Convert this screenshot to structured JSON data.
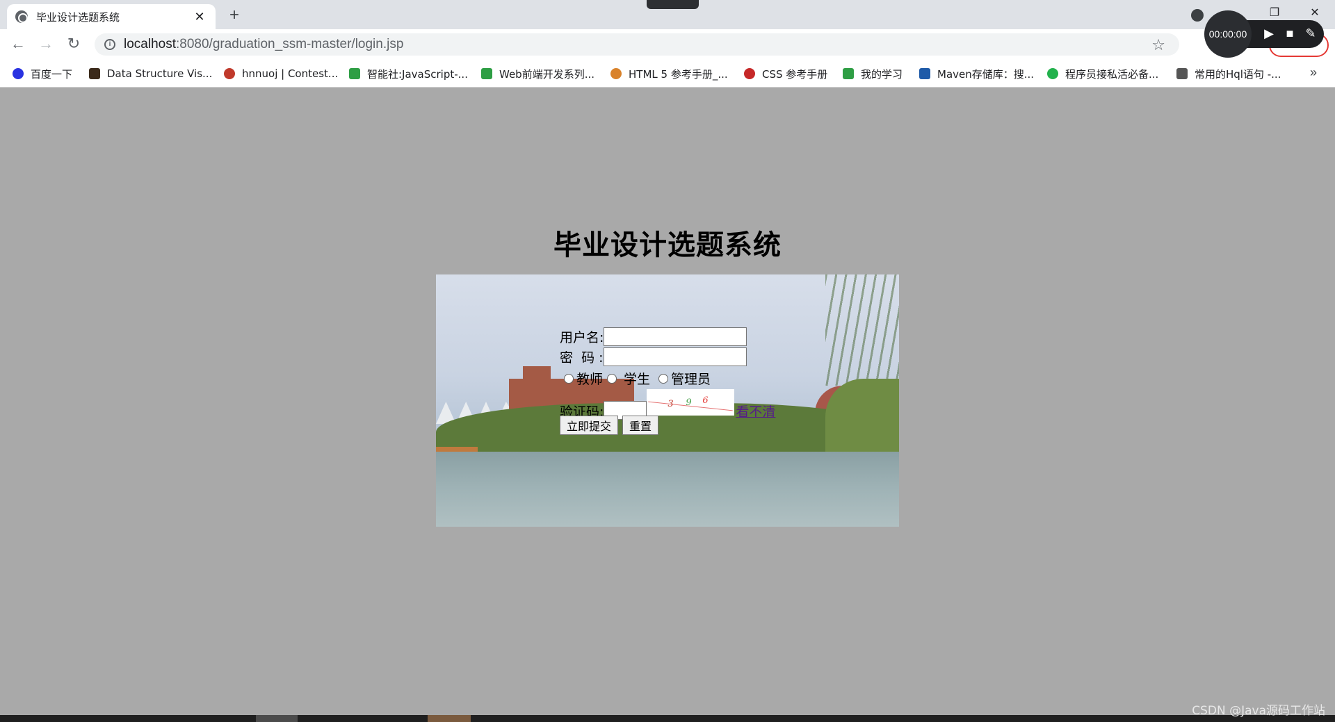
{
  "browser": {
    "tab_title": "毕业设计选题系统",
    "url_host": "localhost",
    "url_path": ":8080/graduation_ssm-master/login.jsp",
    "recorder_time": "00:00:00"
  },
  "bookmarks": [
    {
      "label": "百度一下",
      "color": "#2932e1"
    },
    {
      "label": "Data Structure Vis...",
      "color": "#3b2a1a"
    },
    {
      "label": "hnnuoj | Contest...",
      "color": "#c0392b"
    },
    {
      "label": "智能社:JavaScript-...",
      "color": "#2e9e44"
    },
    {
      "label": "Web前端开发系列...",
      "color": "#2e9e44"
    },
    {
      "label": "HTML 5 参考手册_...",
      "color": "#d9822b"
    },
    {
      "label": "CSS 参考手册",
      "color": "#c62828"
    },
    {
      "label": "我的学习",
      "color": "#2e9e44"
    },
    {
      "label": "Maven存储库：搜...",
      "color": "#1e5aa8"
    },
    {
      "label": "程序员接私活必备...",
      "color": "#22b14c"
    },
    {
      "label": "常用的Hql语句 -...",
      "color": "#555555"
    }
  ],
  "page": {
    "title": "毕业设计选题系统",
    "username_label": "用户名:",
    "password_label": "密  码 :",
    "roles": [
      "教师",
      "学生",
      "管理员"
    ],
    "captcha_label": "验证码:",
    "captcha_chars": [
      "3",
      "9",
      "6"
    ],
    "refresh_link": "看不清",
    "submit_label": "立即提交",
    "reset_label": "重置"
  },
  "watermark": "CSDN @Java源码工作站"
}
